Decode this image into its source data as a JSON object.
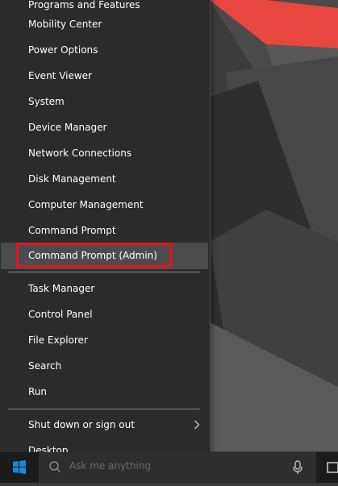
{
  "menu": {
    "items_top": [
      {
        "label": "Programs and Features"
      },
      {
        "label": "Mobility Center"
      },
      {
        "label": "Power Options"
      },
      {
        "label": "Event Viewer"
      },
      {
        "label": "System"
      },
      {
        "label": "Device Manager"
      },
      {
        "label": "Network Connections"
      },
      {
        "label": "Disk Management"
      },
      {
        "label": "Computer Management"
      },
      {
        "label": "Command Prompt"
      },
      {
        "label": "Command Prompt (Admin)"
      }
    ],
    "items_middle": [
      {
        "label": "Task Manager"
      },
      {
        "label": "Control Panel"
      },
      {
        "label": "File Explorer"
      },
      {
        "label": "Search"
      },
      {
        "label": "Run"
      }
    ],
    "items_bottom": [
      {
        "label": "Shut down or sign out"
      },
      {
        "label": "Desktop"
      }
    ],
    "highlighted_item": "Command Prompt (Admin)",
    "submenu_icon": "chevron-right-icon"
  },
  "taskbar": {
    "search_placeholder": "Ask me anything",
    "icons": [
      "windows-logo-icon",
      "search-icon",
      "microphone-icon",
      "task-view-icon"
    ]
  },
  "colors": {
    "menu_bg": "#2b2b2b",
    "highlight_bg": "#4c4c4c",
    "annotation_red": "#e81123",
    "wallpaper_accent": "#e8473f"
  }
}
